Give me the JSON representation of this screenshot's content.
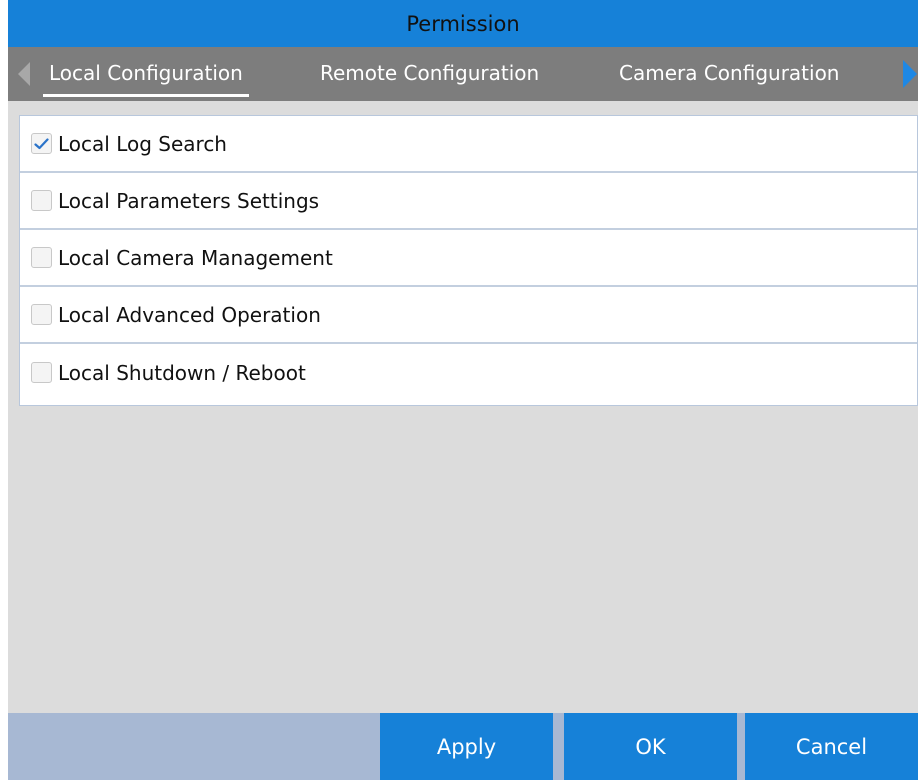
{
  "dialog": {
    "title": "Permission"
  },
  "tabs": [
    {
      "label": "Local Configuration",
      "active": true
    },
    {
      "label": "Remote Configuration",
      "active": false
    },
    {
      "label": "Camera Configuration",
      "active": false
    }
  ],
  "permissions": [
    {
      "label": "Local Log Search",
      "checked": true
    },
    {
      "label": "Local Parameters Settings",
      "checked": false
    },
    {
      "label": "Local Camera Management",
      "checked": false
    },
    {
      "label": "Local Advanced Operation",
      "checked": false
    },
    {
      "label": "Local Shutdown / Reboot",
      "checked": false
    }
  ],
  "buttons": {
    "apply": "Apply",
    "ok": "OK",
    "cancel": "Cancel"
  },
  "icons": {
    "prev": "chevron-left-icon",
    "next": "chevron-right-icon",
    "check": "checkmark-icon"
  },
  "colors": {
    "accent": "#1681d8",
    "tabbar": "#7d7d7d",
    "footer": "#a7b8d3",
    "background": "#dcdcdc"
  }
}
